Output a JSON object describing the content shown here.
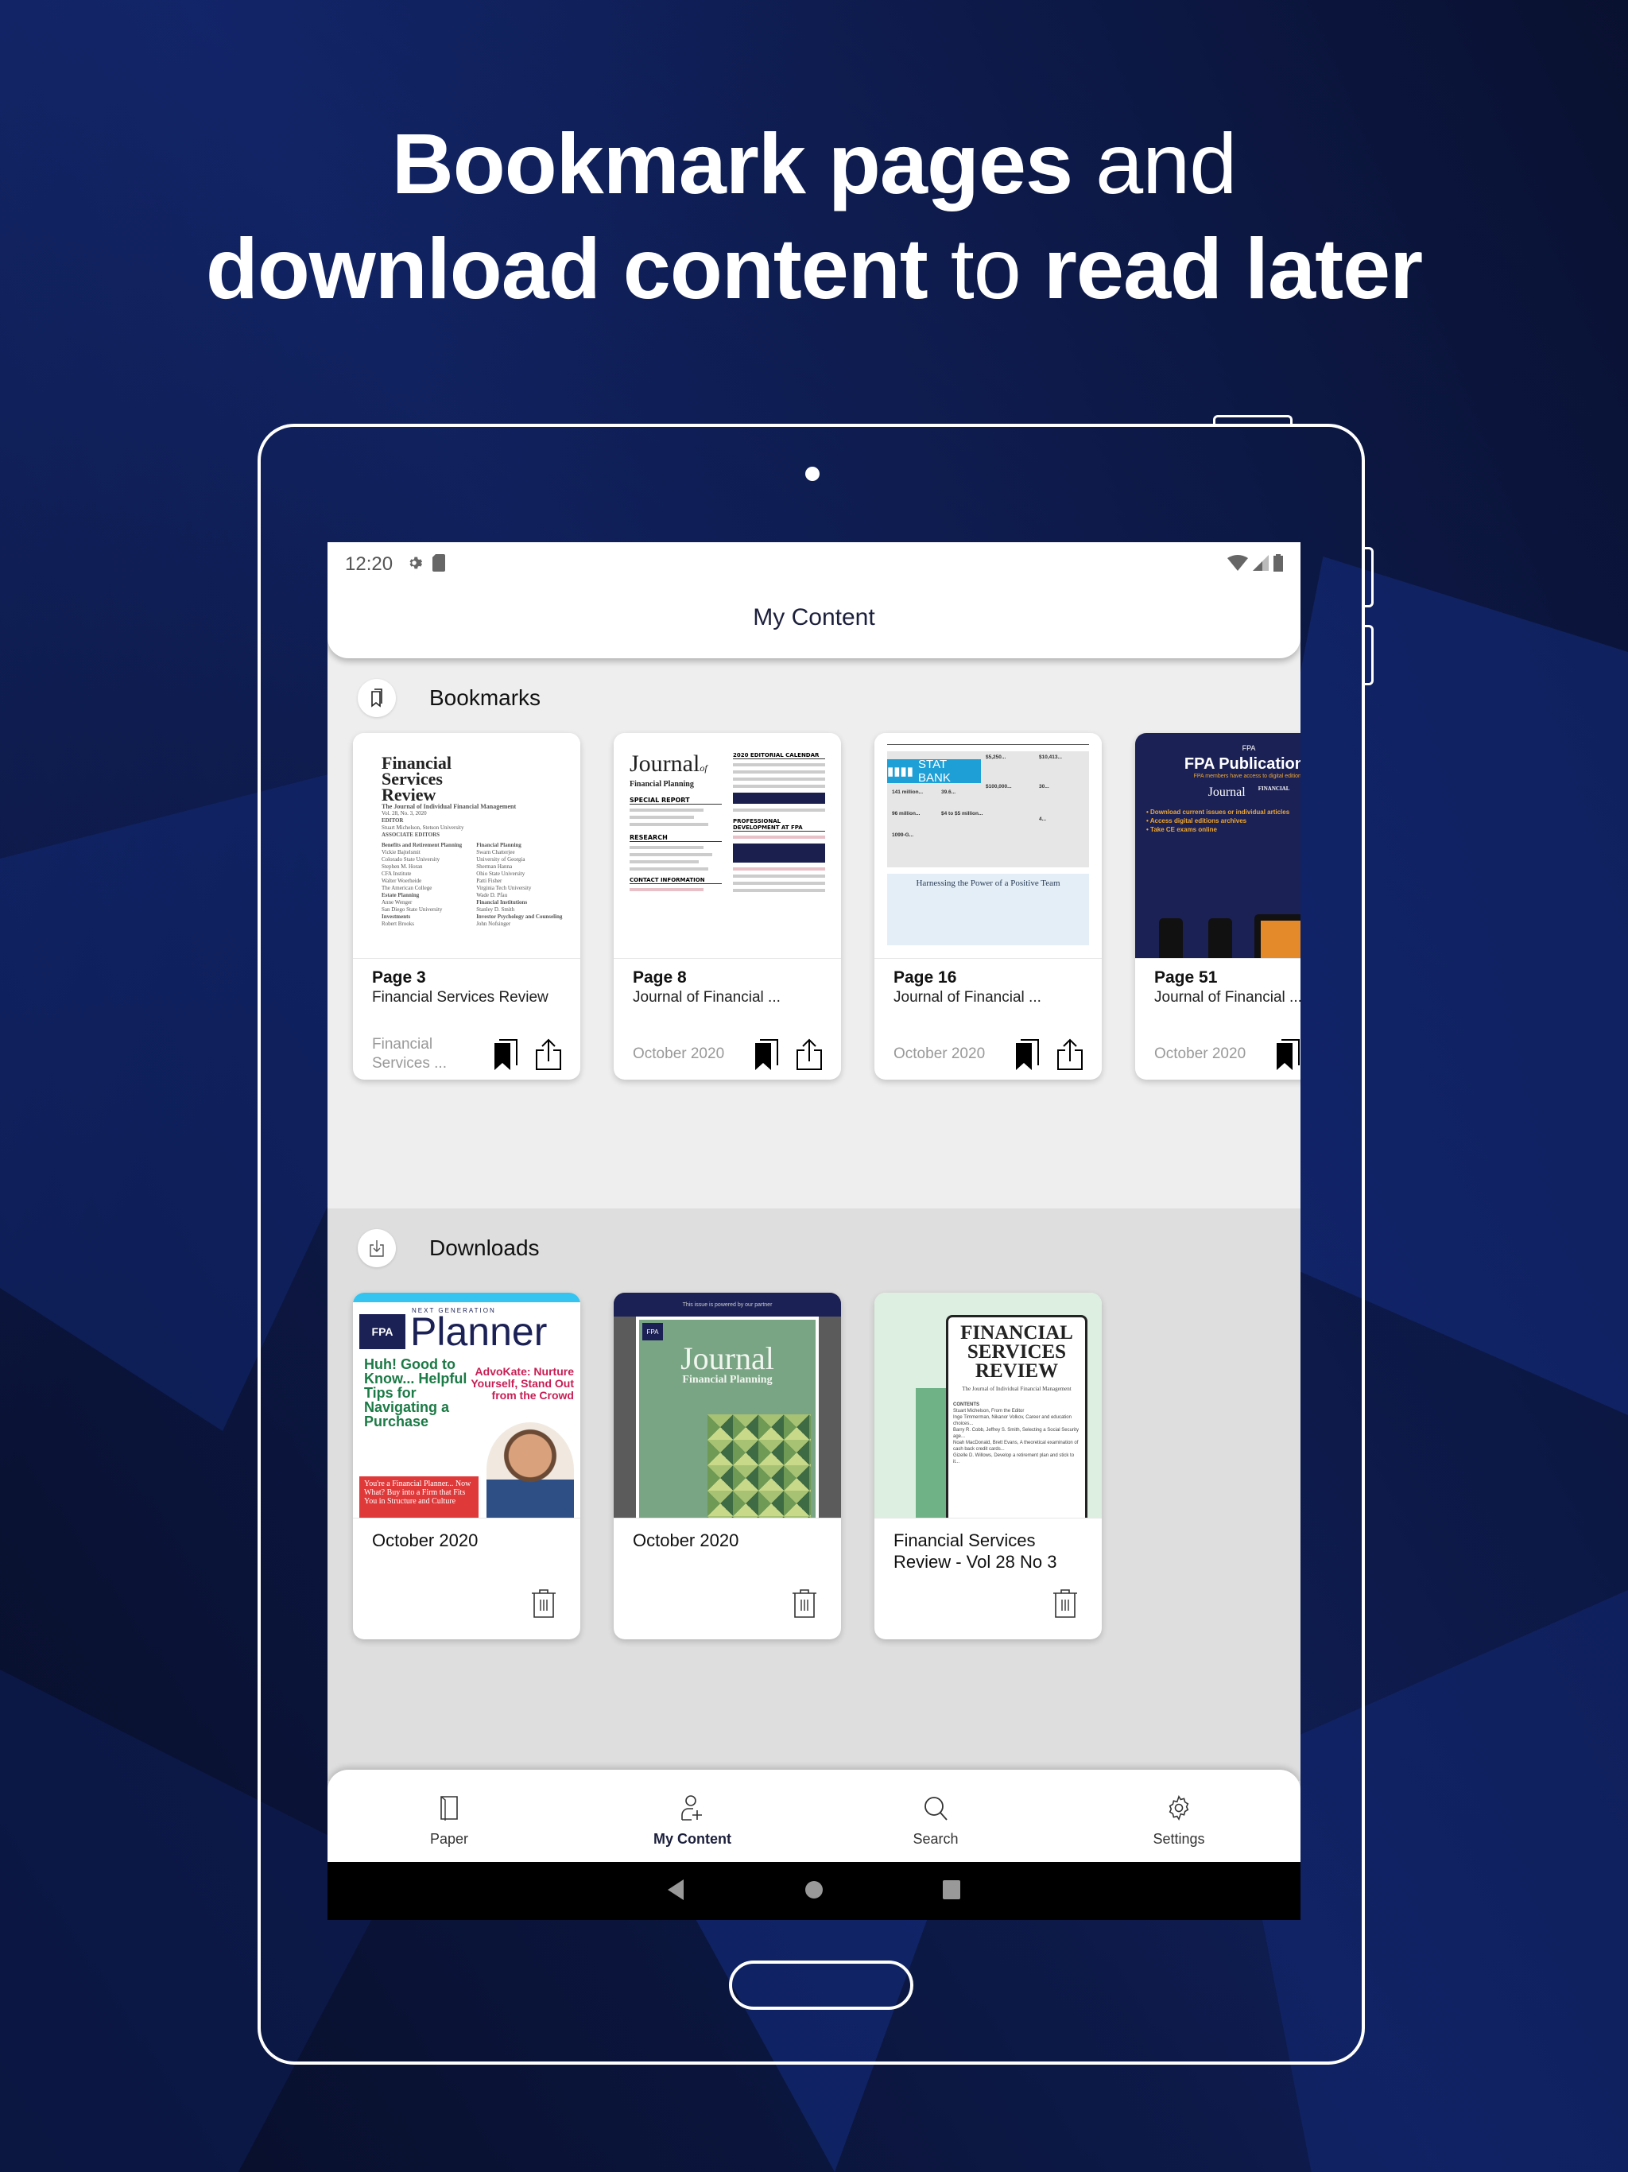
{
  "headline": {
    "line1_bold": "Bookmark pages",
    "line1_light": " and",
    "line2_bold_a": "download content",
    "line2_light": " to ",
    "line2_bold_b": "read later"
  },
  "statusbar": {
    "time": "12:20",
    "left_icons": [
      "gear-icon",
      "sd-card-icon"
    ],
    "right_icons": [
      "wifi-icon",
      "cell-signal-icon",
      "battery-icon"
    ]
  },
  "appbar": {
    "title": "My Content"
  },
  "bookmarks": {
    "title": "Bookmarks",
    "icon": "bookmarks-icon",
    "items": [
      {
        "page": "Page 3",
        "publication": "Financial Services Review",
        "date": "Financial Services ...",
        "thumb": "fsr-editorial-page"
      },
      {
        "page": "Page 8",
        "publication": "Journal of Financial ...",
        "date": "October 2020",
        "thumb": "jfp-contents-page"
      },
      {
        "page": "Page 16",
        "publication": "Journal of Financial ...",
        "date": "October 2020",
        "thumb": "stat-bank-page"
      },
      {
        "page": "Page 51",
        "publication": "Journal of Financial ...",
        "date": "October 2020",
        "thumb": "fpa-publications-ad"
      }
    ]
  },
  "downloads": {
    "title": "Downloads",
    "icon": "download-icon",
    "items": [
      {
        "title": "October 2020",
        "thumb": "next-generation-planner-cover"
      },
      {
        "title": "October 2020",
        "thumb": "journal-of-financial-planning-cover"
      },
      {
        "title": "Financial Services Review - Vol 28 No 3",
        "thumb": "financial-services-review-cover"
      }
    ]
  },
  "thumbs": {
    "fsr": {
      "title_lines": [
        "Financial",
        "Services",
        "Review"
      ],
      "subtitle": "The Journal of Individual Financial Management",
      "volume": "Vol. 28, No. 3, 2020",
      "editor_label": "EDITOR",
      "editor": "Stuart Michelson, Stetson University",
      "assoc_label": "ASSOCIATE EDITORS",
      "col1": [
        "Benefits and Retirement Planning",
        "Vickie Bajtelsmit",
        "Colorado State University",
        "Stephen M. Horan",
        "CFA Institute",
        "Walter Woerheide",
        "The American College",
        "Estate Planning",
        "Anne Wenger",
        "San Diego State University",
        "Investments",
        "Robert Brooks"
      ],
      "col2": [
        "Financial Planning",
        "Swarn Chatterjee",
        "University of Georgia",
        "Sherman Hanna",
        "Ohio State University",
        "Patti Fisher",
        "Virginia Tech University",
        "Wade D. Pfau",
        "Financial Institutions",
        "Stanley D. Smith",
        "Investor Psychology and Counseling",
        "John Nofsinger"
      ]
    },
    "jfp": {
      "logo": "Journal",
      "logo_of": "of",
      "logo_sub": "Financial Planning",
      "special_report": "SPECIAL REPORT",
      "research": "RESEARCH",
      "contact": "CONTACT INFORMATION",
      "calendar": "2020 EDITORIAL CALENDAR",
      "prof_dev": "PROFESSIONAL DEVELOPMENT AT FPA"
    },
    "stat": {
      "banner": "STAT BANK",
      "stats": [
        "141 million...",
        "96 million...",
        "1099-G...",
        "39.6...",
        "$4 to $5 million...",
        "$5,250...",
        "$100,000...",
        "$10,413...",
        "30...",
        "4..."
      ],
      "feature": "Harnessing the Power of a Positive Team"
    },
    "fpa_ad": {
      "brand": "FPA",
      "headline": "FPA Publications",
      "sub": "FPA members have access to digital editions",
      "bullets": [
        "• Download current issues or individual articles",
        "• Access digital editions archives",
        "• Take CE exams online"
      ]
    },
    "planner": {
      "brand": "FPA",
      "kicker": "NEXT GENERATION",
      "logo": "Planner",
      "green": "Huh! Good to Know... Helpful Tips for Navigating a Purchase",
      "pink": "AdvoKate: Nurture Yourself, Stand Out from the Crowd",
      "red": "You're a Financial Planner... Now What? Buy into a Firm that Fits You in Structure and Culture"
    },
    "jfp_cover": {
      "band": "This issue is powered by our partner",
      "brand": "FPA",
      "logo": "Journal",
      "logo_sub": "Financial Planning"
    },
    "fsr_cover": {
      "title_lines": [
        "FINANCIAL",
        "SERVICES",
        "REVIEW"
      ],
      "subtitle": "The Journal of Individual Financial Management",
      "contents": "CONTENTS",
      "toc": [
        "Stuart Michelson, From the Editor",
        "Inge Timmerman, Nikanor Volkov, Career and education choices...",
        "Barry R. Cobb, Jeffrey S. Smith, Selecting a Social Security age...",
        "Noah MacDonald, Brett Evans, A theoretical examination of cash back credit cards...",
        "Gizelle D. Willows, Develop a retirement plan and stick to it..."
      ]
    }
  },
  "bottomnav": {
    "items": [
      {
        "label": "Paper",
        "icon": "paper-icon",
        "active": false
      },
      {
        "label": "My Content",
        "icon": "my-content-icon",
        "active": true
      },
      {
        "label": "Search",
        "icon": "search-icon",
        "active": false
      },
      {
        "label": "Settings",
        "icon": "settings-icon",
        "active": false
      }
    ]
  },
  "sysnav": [
    "back-icon",
    "home-icon",
    "recents-icon"
  ],
  "colors": {
    "background": "#0a1230",
    "title_navy": "#1b1f3b",
    "bookmarks_bg": "#eeeeee",
    "downloads_bg": "#dedede",
    "date_gray": "#999999"
  }
}
